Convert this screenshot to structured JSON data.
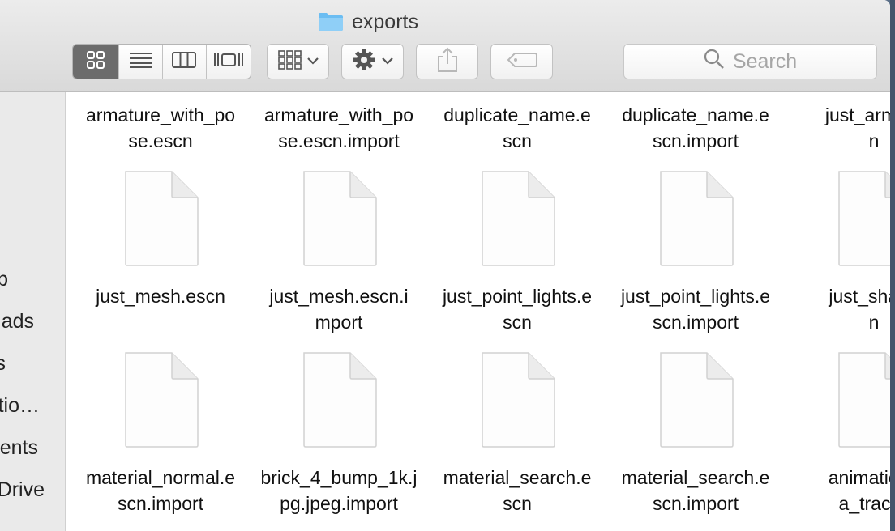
{
  "window": {
    "title": "exports"
  },
  "toolbar": {
    "view_modes": [
      {
        "name": "icon-view-button",
        "icon": "grid-icon",
        "active": true
      },
      {
        "name": "list-view-button",
        "icon": "list-icon",
        "active": false
      },
      {
        "name": "column-view-button",
        "icon": "columns-icon",
        "active": false
      },
      {
        "name": "gallery-view-button",
        "icon": "gallery-icon",
        "active": false
      }
    ],
    "arrange_icon": "arrange-grid-icon",
    "action_icon": "gear-icon",
    "share_icon": "share-icon",
    "tag_icon": "tag-icon"
  },
  "search": {
    "placeholder": "Search"
  },
  "sidebar": {
    "items": [
      {
        "label": "p"
      },
      {
        "label": "ads"
      },
      {
        "label": "s"
      },
      {
        "label": "tio…"
      },
      {
        "label": "ents"
      },
      {
        "label": "Drive"
      }
    ]
  },
  "files": {
    "row1": [
      {
        "l1": "armature_with_po",
        "l2": "se.escn"
      },
      {
        "l1": "armature_with_po",
        "l2": "se.escn.import"
      },
      {
        "l1": "duplicate_name.e",
        "l2": "scn"
      },
      {
        "l1": "duplicate_name.e",
        "l2": "scn.import"
      },
      {
        "l1": "just_armatu",
        "l2": "n"
      }
    ],
    "row2": [
      {
        "l1": "just_mesh.escn",
        "l2": ""
      },
      {
        "l1": "just_mesh.escn.i",
        "l2": "mport"
      },
      {
        "l1": "just_point_lights.e",
        "l2": "scn"
      },
      {
        "l1": "just_point_lights.e",
        "l2": "scn.import"
      },
      {
        "l1": "just_shape",
        "l2": "n"
      }
    ],
    "row3": [
      {
        "l1": "material_normal.e",
        "l2": "scn.import"
      },
      {
        "l1": "brick_4_bump_1k.j",
        "l2": "pg.jpeg.import"
      },
      {
        "l1": "material_search.e",
        "l2": "scn"
      },
      {
        "l1": "material_search.e",
        "l2": "scn.import"
      },
      {
        "l1": "animation_",
        "l2": "a_tracks"
      }
    ]
  },
  "colors": {
    "active_segment": "#6c6c6c",
    "folder_blue": "#5ab4ef",
    "desktop": "#5b6f88"
  }
}
